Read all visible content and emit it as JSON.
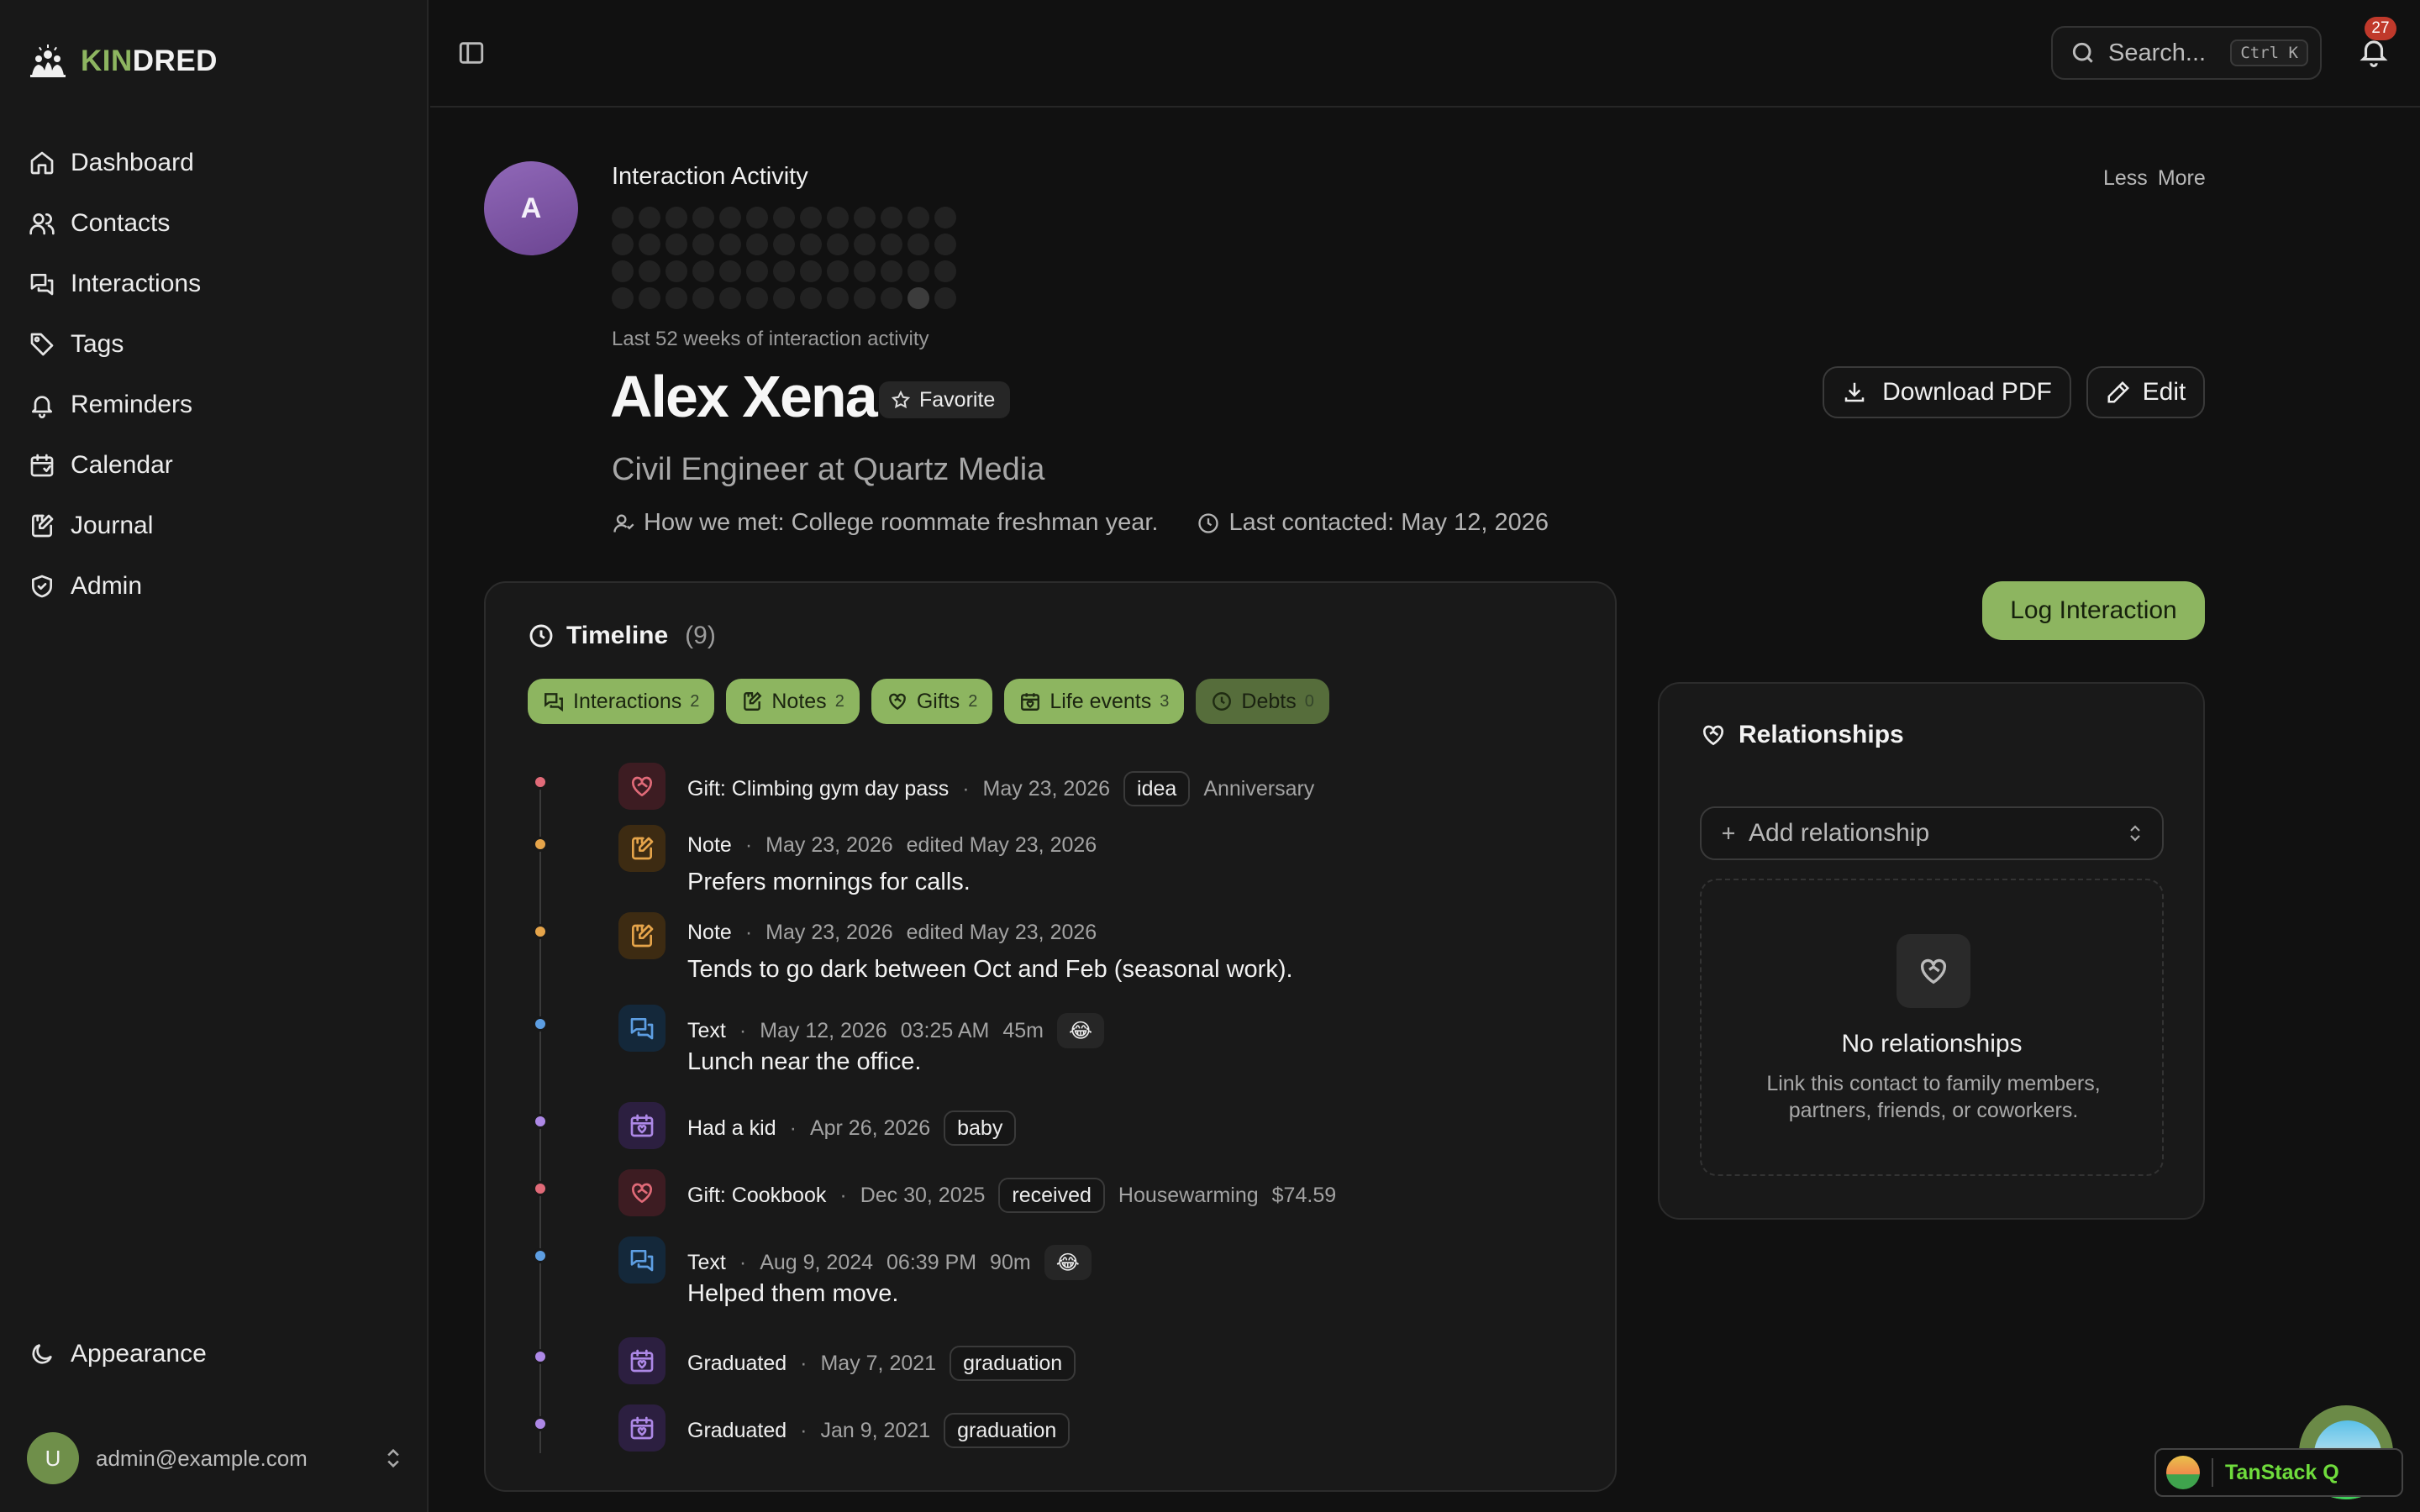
{
  "app": {
    "logo_kin": "KIN",
    "logo_dred": "DRED"
  },
  "sidebar": {
    "items": [
      {
        "label": "Dashboard",
        "icon": "home-icon"
      },
      {
        "label": "Contacts",
        "icon": "users-icon"
      },
      {
        "label": "Interactions",
        "icon": "messages-icon"
      },
      {
        "label": "Tags",
        "icon": "tag-icon"
      },
      {
        "label": "Reminders",
        "icon": "bell-icon"
      },
      {
        "label": "Calendar",
        "icon": "calendar-icon"
      },
      {
        "label": "Journal",
        "icon": "notebook-icon"
      },
      {
        "label": "Admin",
        "icon": "shield-icon"
      }
    ],
    "appearance_label": "Appearance",
    "user_initial": "U",
    "user_email": "admin@example.com"
  },
  "topbar": {
    "search_placeholder": "Search...",
    "search_shortcut": "Ctrl K",
    "notification_count": "27"
  },
  "contact": {
    "avatar_initial": "A",
    "activity_title": "Interaction Activity",
    "activity_less": "Less",
    "activity_more": "More",
    "activity_subtitle": "Last 52 weeks of interaction activity",
    "name": "Alex Xena",
    "favorite_label": "Favorite",
    "job": "Civil Engineer at Quartz Media",
    "how_we_met": "How we met: College roommate freshman year.",
    "last_contacted": "Last contacted: May 12, 2026",
    "download_pdf_label": "Download PDF",
    "edit_label": "Edit"
  },
  "timeline": {
    "title": "Timeline",
    "count": "(9)",
    "filters": [
      {
        "label": "Interactions",
        "count": "2",
        "active": true
      },
      {
        "label": "Notes",
        "count": "2",
        "active": true
      },
      {
        "label": "Gifts",
        "count": "2",
        "active": true
      },
      {
        "label": "Life events",
        "count": "3",
        "active": true
      },
      {
        "label": "Debts",
        "count": "0",
        "active": false
      }
    ],
    "entries": [
      {
        "kind": "gift",
        "title": "Gift: Climbing gym day pass",
        "sep": "·",
        "date": "May 23, 2026",
        "pill": "idea",
        "extra": "Anniversary"
      },
      {
        "kind": "note",
        "title": "Note",
        "sep": "·",
        "date": "May 23, 2026",
        "edited": "edited May 23, 2026",
        "body": "Prefers mornings for calls."
      },
      {
        "kind": "note",
        "title": "Note",
        "sep": "·",
        "date": "May 23, 2026",
        "edited": "edited May 23, 2026",
        "body": "Tends to go dark between Oct and Feb (seasonal work)."
      },
      {
        "kind": "text",
        "title": "Text",
        "sep": "·",
        "date": "May 12, 2026",
        "time": "03:25 AM",
        "duration": "45m",
        "emoji": "😂",
        "body": "Lunch near the office."
      },
      {
        "kind": "event",
        "title": "Had a kid",
        "sep": "·",
        "date": "Apr 26, 2026",
        "pill": "baby"
      },
      {
        "kind": "gift",
        "title": "Gift: Cookbook",
        "sep": "·",
        "date": "Dec 30, 2025",
        "pill": "received",
        "extra": "Housewarming",
        "amount": "$74.59"
      },
      {
        "kind": "text",
        "title": "Text",
        "sep": "·",
        "date": "Aug 9, 2024",
        "time": "06:39 PM",
        "duration": "90m",
        "emoji": "😂",
        "body": "Helped them move."
      },
      {
        "kind": "event",
        "title": "Graduated",
        "sep": "·",
        "date": "May 7, 2021",
        "pill": "graduation"
      },
      {
        "kind": "event",
        "title": "Graduated",
        "sep": "·",
        "date": "Jan 9, 2021",
        "pill": "graduation"
      }
    ]
  },
  "actions": {
    "log_interaction_label": "Log Interaction"
  },
  "relationships": {
    "title": "Relationships",
    "add_placeholder": "Add relationship",
    "empty_title": "No relationships",
    "empty_desc": "Link this contact to family members, partners, friends, or coworkers."
  },
  "devtools": {
    "label": "TanStack Q"
  },
  "colors": {
    "accent": "#8db560",
    "gift": "#e06a78",
    "note": "#e5a44a",
    "text": "#5d9ee2",
    "event": "#ad88e6"
  }
}
